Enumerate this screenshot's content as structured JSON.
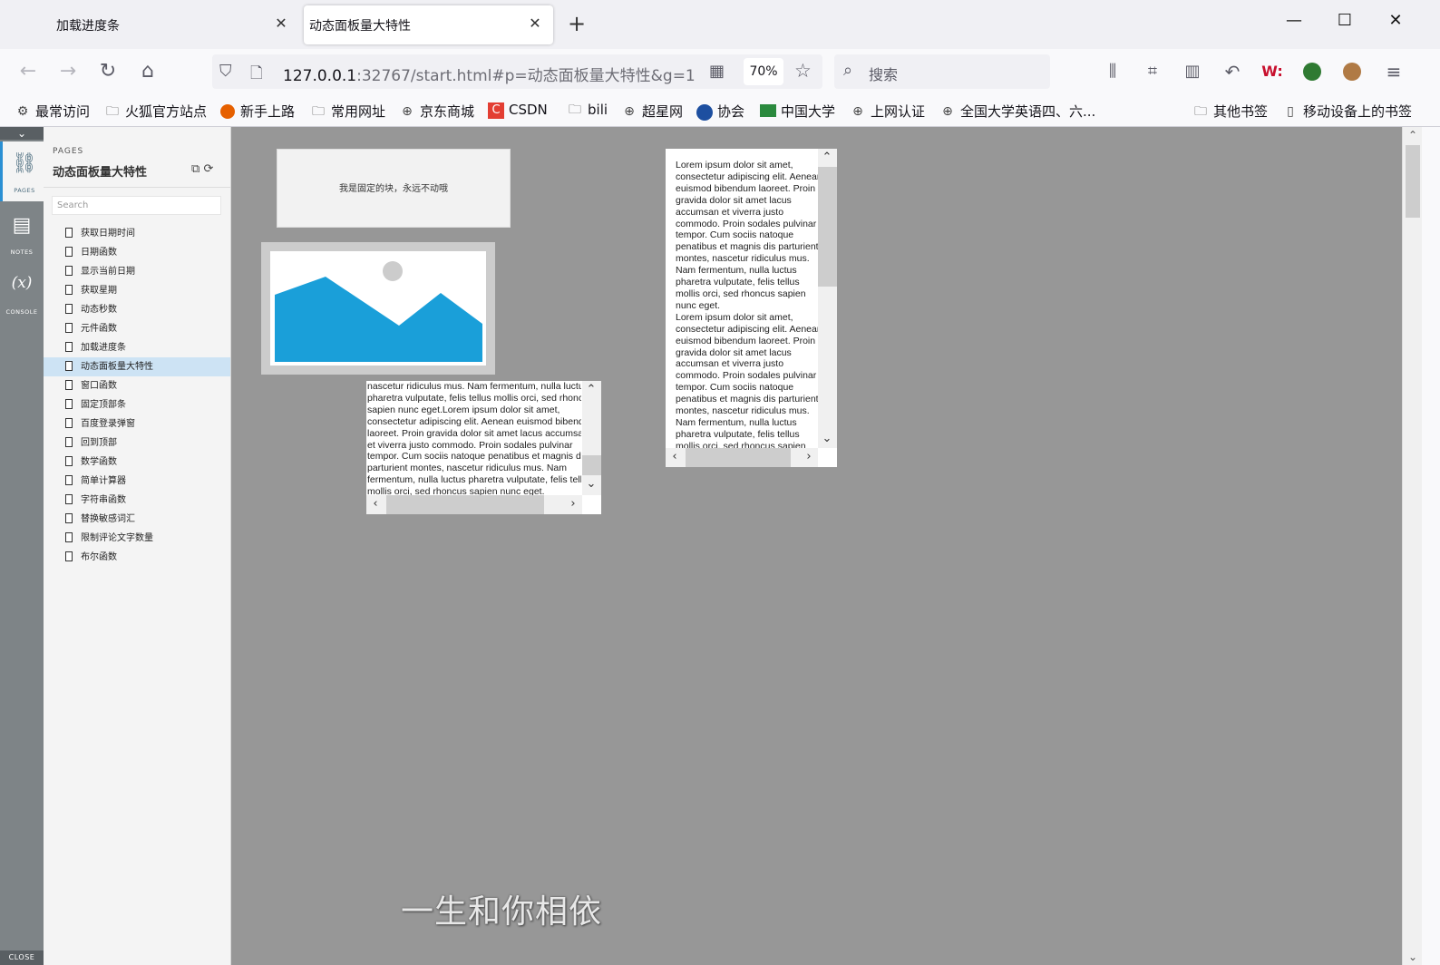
{
  "tabs": [
    {
      "title": "加载进度条",
      "active": false
    },
    {
      "title": "动态面板量大特性",
      "active": true
    }
  ],
  "window_controls": {
    "minimize": "—",
    "maximize": "☐",
    "close": "✕"
  },
  "nav": {
    "url_host": "127.0.0.1",
    "url_rest": ":32767/start.html#p=动态面板量大特性&g=1",
    "zoom": "70%",
    "search_placeholder": "搜索"
  },
  "bookmarks": [
    {
      "label": "最常访问",
      "icon": "gear-icon"
    },
    {
      "label": "火狐官方站点",
      "icon": "folder-icon"
    },
    {
      "label": "新手上路",
      "icon": "firefox-icon"
    },
    {
      "label": "常用网址",
      "icon": "folder-icon"
    },
    {
      "label": "京东商城",
      "icon": "globe-icon"
    },
    {
      "label": "CSDN",
      "icon": "csdn-icon"
    },
    {
      "label": "bili",
      "icon": "folder-icon"
    },
    {
      "label": "超星网",
      "icon": "globe-icon"
    },
    {
      "label": "协会",
      "icon": "globe-icon"
    },
    {
      "label": "中国大学",
      "icon": "book-icon"
    },
    {
      "label": "上网认证",
      "icon": "globe-icon"
    },
    {
      "label": "全国大学英语四、六...",
      "icon": "globe-icon"
    },
    {
      "label": "其他书签",
      "icon": "folder-icon"
    },
    {
      "label": "移动设备上的书签",
      "icon": "mobile-icon"
    }
  ],
  "rail": {
    "pages_label": "PAGES",
    "notes_label": "NOTES",
    "console_label": "CONSOLE",
    "close_label": "CLOSE"
  },
  "pages_panel": {
    "header": "PAGES",
    "title": "动态面板量大特性",
    "search_placeholder": "Search",
    "items": [
      "获取日期时间",
      "日期函数",
      "显示当前日期",
      "获取星期",
      "动态秒数",
      "元件函数",
      "加载进度条",
      "动态面板量大特性",
      "窗口函数",
      "固定顶部条",
      "百度登录弹窗",
      "回到顶部",
      "数学函数",
      "简单计算器",
      "字符串函数",
      "替换敏感词汇",
      "限制评论文字数量",
      "布尔函数"
    ],
    "selected_index": 7
  },
  "canvas": {
    "fixed_block_text": "我是固定的块，永远不动哦",
    "scroll_text_left": "nascetur ridiculus mus. Nam fermentum, nulla luctus\npharetra vulputate, felis tellus mollis orci, sed rhoncus\nsapien nunc eget.Lorem ipsum dolor sit amet,\nconsectetur adipiscing elit. Aenean euismod bibendum\nlaoreet. Proin gravida dolor sit amet lacus accumsan\net viverra justo commodo. Proin sodales pulvinar\ntempor. Cum sociis natoque penatibus et magnis dis\nparturient montes, nascetur ridiculus mus. Nam\nfermentum, nulla luctus pharetra vulputate, felis tellus\nmollis orci, sed rhoncus sapien nunc eget.",
    "scroll_text_right": "Lorem ipsum dolor sit amet,\nconsectetur adipiscing elit. Aenean\neuismod bibendum laoreet. Proin\ngravida dolor sit amet lacus\naccumsan et viverra justo\ncommodo. Proin sodales pulvinar\ntempor. Cum sociis natoque\npenatibus et magnis dis parturient\nmontes, nascetur ridiculus mus.\nNam fermentum, nulla luctus\npharetra vulputate, felis tellus\nmollis orci, sed rhoncus sapien\nnunc eget.\nLorem ipsum dolor sit amet,\nconsectetur adipiscing elit. Aenean\neuismod bibendum laoreet. Proin\ngravida dolor sit amet lacus\naccumsan et viverra justo\ncommodo. Proin sodales pulvinar\ntempor. Cum sociis natoque\npenatibus et magnis dis parturient\nmontes, nascetur ridiculus mus.\nNam fermentum, nulla luctus\npharetra vulputate, felis tellus\nmollis orci, sed rhoncus sapien",
    "subtitle": "一生和你相依"
  },
  "colors": {
    "canvas_bg": "#979797",
    "selected_page_bg": "#cde3f4",
    "image_placeholder_blue": "#1a9fd9",
    "image_placeholder_circle": "#cccccc"
  }
}
